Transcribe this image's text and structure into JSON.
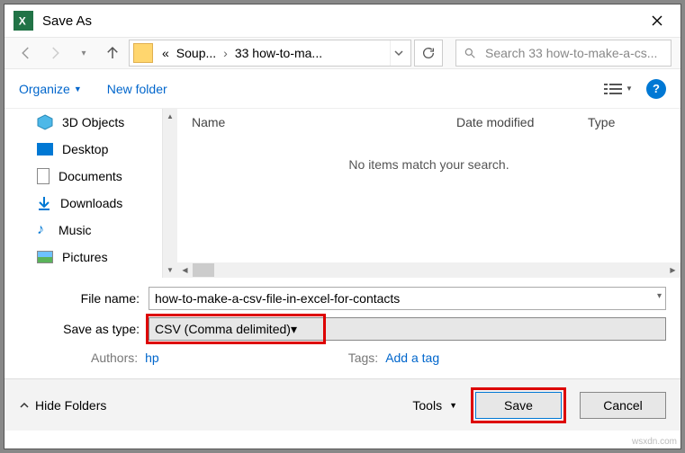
{
  "title": "Save As",
  "breadcrumb": {
    "seg1": "Soup...",
    "seg2": "33 how-to-ma..."
  },
  "search_placeholder": "Search 33 how-to-make-a-cs...",
  "toolbar": {
    "organize": "Organize",
    "new_folder": "New folder"
  },
  "tree": [
    {
      "icon": "3d",
      "label": "3D Objects"
    },
    {
      "icon": "desktop",
      "label": "Desktop"
    },
    {
      "icon": "doc",
      "label": "Documents"
    },
    {
      "icon": "down",
      "label": "Downloads"
    },
    {
      "icon": "music",
      "label": "Music"
    },
    {
      "icon": "pic",
      "label": "Pictures"
    }
  ],
  "columns": {
    "name": "Name",
    "date": "Date modified",
    "type": "Type"
  },
  "empty_msg": "No items match your search.",
  "file_name_label": "File name:",
  "file_name_value": "how-to-make-a-csv-file-in-excel-for-contacts",
  "save_type_label": "Save as type:",
  "save_type_value": "CSV (Comma delimited)",
  "authors_label": "Authors:",
  "authors_value": "hp",
  "tags_label": "Tags:",
  "tags_value": "Add a tag",
  "hide_folders": "Hide Folders",
  "tools_label": "Tools",
  "save_btn": "Save",
  "cancel_btn": "Cancel",
  "watermark": "wsxdn.com"
}
